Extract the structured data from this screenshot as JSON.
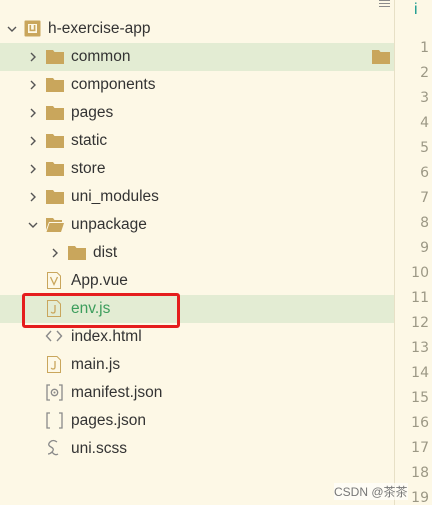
{
  "project": {
    "name": "h-exercise-app"
  },
  "tree": [
    {
      "name": "common",
      "type": "folder"
    },
    {
      "name": "components",
      "type": "folder"
    },
    {
      "name": "pages",
      "type": "folder"
    },
    {
      "name": "static",
      "type": "folder"
    },
    {
      "name": "store",
      "type": "folder"
    },
    {
      "name": "uni_modules",
      "type": "folder"
    },
    {
      "name": "unpackage",
      "type": "folder"
    },
    {
      "name": "dist",
      "type": "folder"
    },
    {
      "name": "App.vue",
      "type": "vue-file"
    },
    {
      "name": "env.js",
      "type": "js-file"
    },
    {
      "name": "index.html",
      "type": "html-file"
    },
    {
      "name": "main.js",
      "type": "js-file"
    },
    {
      "name": "manifest.json",
      "type": "manifest-file"
    },
    {
      "name": "pages.json",
      "type": "json-file"
    },
    {
      "name": "uni.scss",
      "type": "scss-file"
    }
  ],
  "gutter": {
    "tab_mark": "i",
    "lines": [
      "1",
      "2",
      "3",
      "4",
      "5",
      "6",
      "7",
      "8",
      "9",
      "10",
      "11",
      "12",
      "13",
      "14",
      "15",
      "16",
      "17",
      "18",
      "19"
    ]
  },
  "watermark": "CSDN @茶茶",
  "colors": {
    "background": "#fdf8e6",
    "selection": "#e3ecd3",
    "folder": "#c9a65c",
    "highlight": "#e51d1d",
    "active_file_text": "#3c9d5c"
  }
}
